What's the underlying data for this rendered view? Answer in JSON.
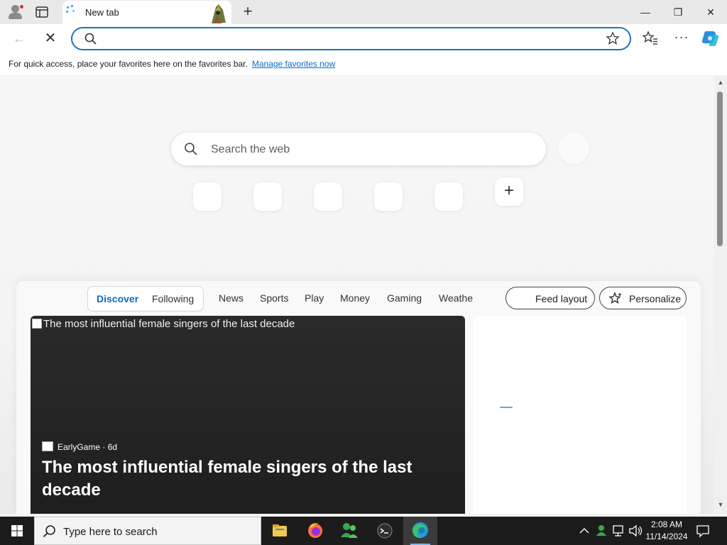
{
  "browser": {
    "tab": {
      "title": "New tab"
    },
    "new_tab_glyph": "+",
    "window_controls": {
      "minimize": "—",
      "restore": "❐",
      "close": "✕"
    },
    "nav": {
      "back_glyph": "←",
      "stop_glyph": "✕",
      "more_glyph": "···"
    },
    "address": {
      "value": "",
      "placeholder": ""
    },
    "favorites_bar": {
      "message": "For quick access, place your favorites here on the favorites bar.",
      "link": "Manage favorites now"
    },
    "accent_color": "#1d72c5"
  },
  "new_tab_page": {
    "search": {
      "placeholder": "Search the web"
    },
    "add_tile_glyph": "+",
    "feed": {
      "tabs": [
        {
          "label": "Discover",
          "active": true
        },
        {
          "label": "Following",
          "active": false
        }
      ],
      "categories": [
        "News",
        "Sports",
        "Play",
        "Money",
        "Gaming",
        "Weathe"
      ],
      "feed_layout_label": "Feed layout",
      "personalize_label": "Personalize",
      "hero": {
        "image_alt": "The most influential female singers of the last decade",
        "source": "EarlyGame",
        "age": "· 6d",
        "headline": "The most influential female singers of the last decade"
      }
    }
  },
  "taskbar": {
    "search_placeholder": "Type here to search",
    "apps": [
      "file-explorer-icon",
      "firefox-icon",
      "people-app-icon",
      "terminal-icon",
      "edge-icon"
    ],
    "active_app": "edge-icon",
    "tray": {
      "chevron": "^"
    },
    "clock": {
      "time": "2:08 AM",
      "date": "11/14/2024"
    }
  }
}
